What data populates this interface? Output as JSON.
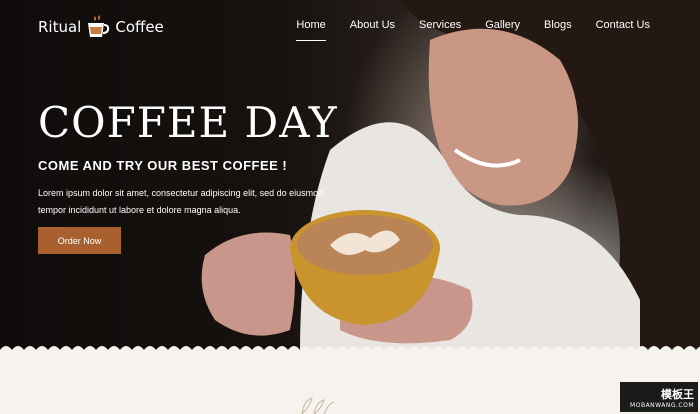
{
  "brand": {
    "left_word": "Ritual",
    "right_word": "Coffee",
    "icon": "coffee-cup-icon"
  },
  "nav": {
    "items": [
      {
        "label": "Home",
        "active": true
      },
      {
        "label": "About Us",
        "active": false
      },
      {
        "label": "Services",
        "active": false
      },
      {
        "label": "Gallery",
        "active": false
      },
      {
        "label": "Blogs",
        "active": false
      },
      {
        "label": "Contact Us",
        "active": false
      }
    ]
  },
  "hero": {
    "title": "COFFEE DAY",
    "subtitle": "COME AND TRY OUR BEST COFFEE !",
    "text": "Lorem ipsum dolor sit amet, consectetur adipiscing elit, sed do eiusmod tempor incididunt ut labore et dolore magna aliqua.",
    "button_label": "Order Now"
  },
  "watermark": {
    "top": "模板王",
    "bottom": "MOBANWANG.COM"
  },
  "colors": {
    "accent": "#a8602f",
    "hero_bg": "#17120f",
    "lower_bg": "#f6f3ee"
  }
}
